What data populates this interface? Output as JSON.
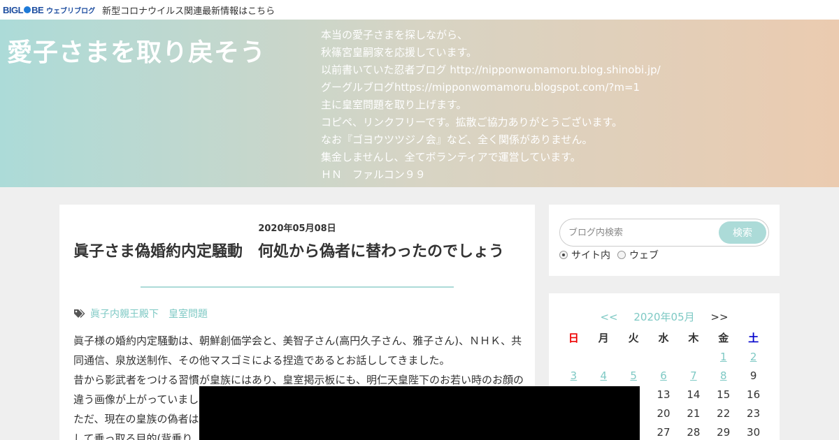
{
  "topbar": {
    "logo_left": "BIGL",
    "logo_right": "BE",
    "logo_sub": "ウェブリブログ",
    "notice_link": "新型コロナウイルス関連最新情報はこちら"
  },
  "header": {
    "title": "愛子さまを取り戻そう",
    "description": [
      "本当の愛子さまを探しながら、",
      "秋篠宮皇嗣家を応援しています。",
      "以前書いていた忍者ブログ http://nipponwomamoru.blog.shinobi.jp/",
      "グーグルブログhttps://mipponwomamoru.blogspot.com/?m=1",
      "主に皇室問題を取り上げます。",
      "コピペ、リンクフリーです。拡散ご協力ありがとうございます。",
      "なお『ゴヨウツツジノ会』など、全く関係がありません。",
      "集金しませんし、全てボランティアで運営しています。",
      "ＨＮ　ファルコン９９"
    ]
  },
  "article": {
    "date": "2020年05月08日",
    "title": "眞子さま偽婚約内定騒動　何処から偽者に替わったのでしょう",
    "tags": [
      "眞子内親王殿下",
      "皇室問題"
    ],
    "paragraphs": [
      "眞子様の婚約内定騒動は、朝鮮創価学会と、美智子さん(高円久子さん、雅子さん)、ＮＨＫ、共同通信、泉放送制作、その他マスゴミによる捏造であるとお話ししてきました。",
      "昔から影武者をつける習慣が皇族にはあり、皇室掲示板にも、明仁天皇陛下のお若い時のお顔の違う画像が上がっていました。",
      "ただ、現在の皇族の偽者は",
      "して乗っ取る目的(背乗り"
    ]
  },
  "search": {
    "placeholder": "ブログ内検索",
    "button": "検索",
    "option_site": "サイト内",
    "option_web": "ウェブ"
  },
  "calendar": {
    "prev": "<<",
    "month": "2020年05月",
    "next": ">>",
    "weekdays": [
      "日",
      "月",
      "火",
      "水",
      "木",
      "金",
      "土"
    ],
    "rows": [
      [
        "",
        "",
        "",
        "",
        "",
        "1",
        "2"
      ],
      [
        "3",
        "4",
        "5",
        "6",
        "7",
        "8",
        "9"
      ],
      [
        "",
        "",
        "",
        "",
        "13",
        "15",
        "16"
      ],
      [
        "",
        "",
        "",
        "",
        "20",
        "21",
        "22",
        "23"
      ],
      [
        "",
        "",
        "",
        "",
        "27",
        "28",
        "29",
        "30"
      ]
    ],
    "row3": [
      "",
      "",
      "",
      "13",
      "14",
      "15",
      "16"
    ],
    "row4": [
      "",
      "",
      "",
      "20",
      "21",
      "22",
      "23"
    ],
    "row5": [
      "",
      "",
      "",
      "27",
      "28",
      "29",
      "30"
    ]
  }
}
